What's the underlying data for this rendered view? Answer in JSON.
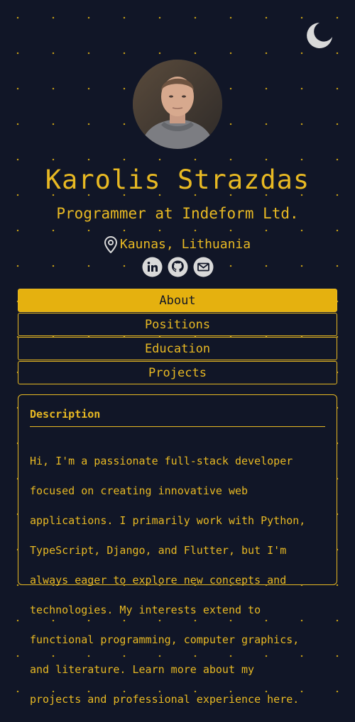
{
  "header": {
    "theme_toggle_icon": "moon-icon",
    "theme_toggle_color": "#d9d9d9"
  },
  "profile": {
    "avatar_icon": "profile-photo",
    "name": "Karolis Strazdas",
    "role": "Programmer at Indeform Ltd.",
    "location_icon": "map-pin-icon",
    "location": "Kaunas, Lithuania",
    "socials": [
      {
        "icon": "linkedin-icon"
      },
      {
        "icon": "github-icon"
      },
      {
        "icon": "mail-icon"
      }
    ]
  },
  "tabs": [
    {
      "label": "About",
      "active": true
    },
    {
      "label": "Positions",
      "active": false
    },
    {
      "label": "Education",
      "active": false
    },
    {
      "label": "Projects",
      "active": false
    }
  ],
  "about": {
    "title": "Description",
    "text_line_1": "Hi, I'm a passionate full-stack developer",
    "text_line_2": "focused on creating innovative web",
    "text_line_3": "applications. I primarily work with Python,",
    "text_line_4": "TypeScript, Django, and Flutter, but I'm",
    "text_line_5": "always eager to explore new concepts and",
    "text_line_6": "technologies. My interests extend to",
    "text_line_7": "functional programming, computer graphics,",
    "text_line_8": "and literature. Learn more about my",
    "text_line_9": "projects and professional experience here."
  },
  "colors": {
    "background": "#111627",
    "accent": "#e8b923",
    "active_tab": "#e5b10f",
    "icon_gray": "#d9d9d9"
  }
}
